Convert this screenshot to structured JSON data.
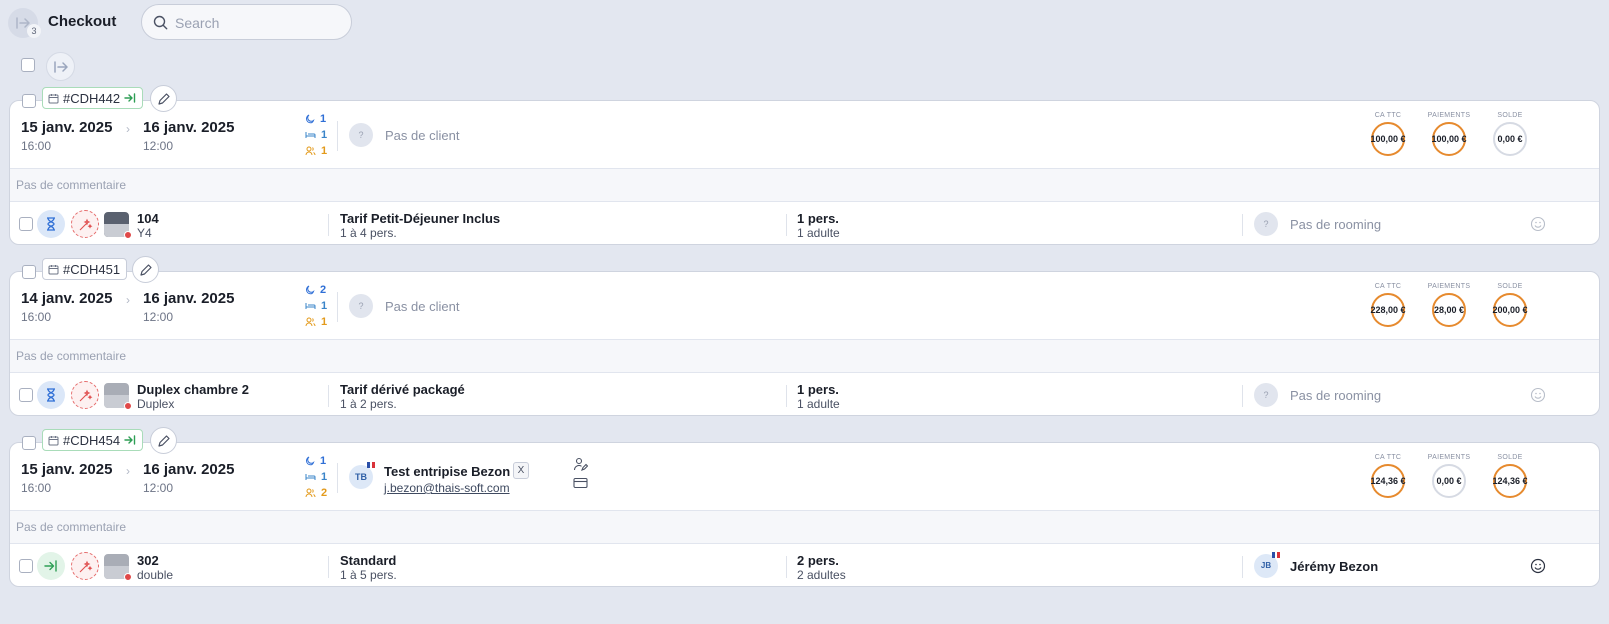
{
  "header": {
    "title": "Checkout",
    "count": "3",
    "search_placeholder": "Search",
    "search_value": ""
  },
  "labels": {
    "ca_ttc": "CA TTC",
    "paiements": "PAIEMENTS",
    "solde": "SOLDE"
  },
  "colors": {
    "background": "#e3e7f0",
    "nights": "#2f6fd6",
    "persons": "#e39a1b",
    "ring_orange": "#e68a2e",
    "checkin_green": "#2e9e55",
    "alert_red": "#e04848"
  },
  "bookings": [
    {
      "ref": "#CDH442",
      "ref_status": "checkin-arrow",
      "arrival_date": "15 janv. 2025",
      "arrival_time": "16:00",
      "departure_date": "16 janv. 2025",
      "departure_time": "12:00",
      "nights": "1",
      "rooms": "1",
      "persons": "1",
      "client_text": "Pas de client",
      "client_avatar": "?",
      "ca_ttc": "100,00 €",
      "paiements": "100,00 €",
      "solde": "0,00 €",
      "comment": "Pas de commentaire",
      "room": {
        "name": "104",
        "type": "Y4",
        "status_icon": "hourglass-icon",
        "rate_name": "Tarif Petit-Déjeuner Inclus",
        "rate_sub": "1 à 4 pers.",
        "persons": "1 pers.",
        "persons_sub": "1 adulte",
        "rooming_avatar": "?",
        "rooming": "Pas de rooming"
      }
    },
    {
      "ref": "#CDH451",
      "ref_status": "none",
      "arrival_date": "14 janv. 2025",
      "arrival_time": "16:00",
      "departure_date": "16 janv. 2025",
      "departure_time": "12:00",
      "nights": "2",
      "rooms": "1",
      "persons": "1",
      "client_text": "Pas de client",
      "client_avatar": "?",
      "ca_ttc": "228,00 €",
      "paiements": "28,00 €",
      "solde": "200,00 €",
      "comment": "Pas de commentaire",
      "room": {
        "name": "Duplex chambre 2",
        "type": "Duplex",
        "status_icon": "hourglass-icon",
        "rate_name": "Tarif dérivé packagé",
        "rate_sub": "1 à 2 pers.",
        "persons": "1 pers.",
        "persons_sub": "1 adulte",
        "rooming_avatar": "?",
        "rooming": "Pas de rooming"
      }
    },
    {
      "ref": "#CDH454",
      "ref_status": "checkin-arrow",
      "arrival_date": "15 janv. 2025",
      "arrival_time": "16:00",
      "departure_date": "16 janv. 2025",
      "departure_time": "12:00",
      "nights": "1",
      "rooms": "1",
      "persons": "2",
      "client_initials": "TB",
      "client_name": "Test entripise Bezon",
      "client_remove": "X",
      "client_email": "j.bezon@thais-soft.com",
      "ca_ttc": "124,36 €",
      "paiements": "0,00 €",
      "solde": "124,36 €",
      "comment": "Pas de commentaire",
      "room": {
        "name": "302",
        "type": "double",
        "status_icon": "checkin-arrow-icon",
        "rate_name": "Standard",
        "rate_sub": "1 à 5 pers.",
        "persons": "2 pers.",
        "persons_sub": "2 adultes",
        "rooming_avatar": "JB",
        "rooming": "Jérémy Bezon"
      }
    }
  ]
}
